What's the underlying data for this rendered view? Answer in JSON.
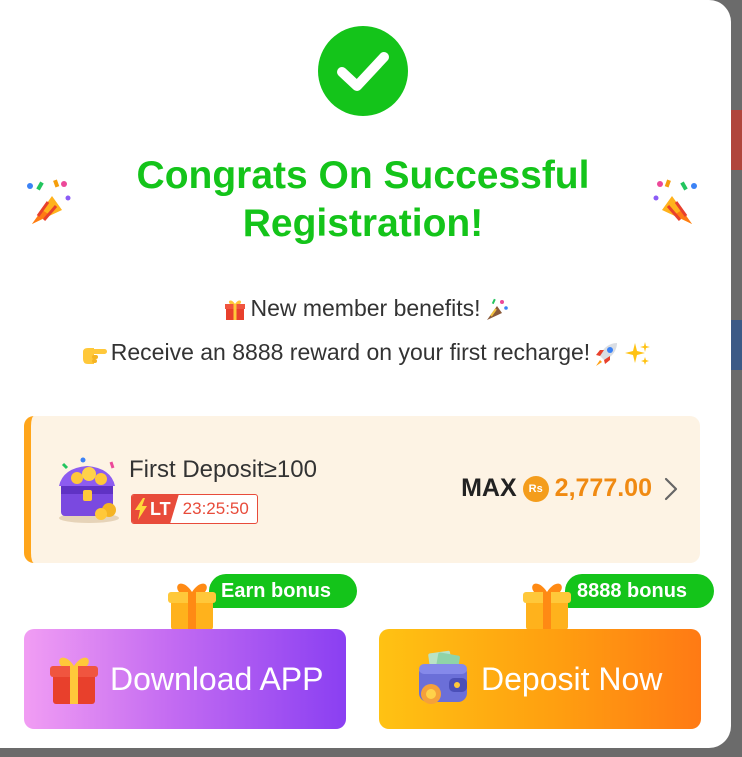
{
  "modal": {
    "title": "Congrats On Successful Registration!",
    "benefits_line": "New member benefits!",
    "reward_line": "Receive an 8888 reward on your first recharge!"
  },
  "deposit_offer": {
    "label": "First Deposit≥100",
    "limited_tag": "LT",
    "countdown": "23:25:50",
    "max_label": "MAX",
    "currency_symbol": "Rs",
    "max_amount": "2,777.00"
  },
  "actions": {
    "download_bonus_tag": "Earn bonus",
    "download_label": "Download APP",
    "deposit_bonus_tag": "8888 bonus",
    "deposit_label": "Deposit Now"
  },
  "icons": {
    "success": "check-circle-icon",
    "party_left": "party-popper-icon",
    "party_right": "party-popper-icon",
    "gift": "gift-icon",
    "pointing": "pointing-hand-icon",
    "rocket": "rocket-icon",
    "sparkles": "sparkles-icon",
    "chest": "treasure-chest-icon",
    "bolt": "lightning-icon",
    "coin": "rupee-coin-icon",
    "chevron": "chevron-right-icon",
    "wallet": "wallet-icon"
  },
  "colors": {
    "success_green": "#14c41a",
    "accent_orange": "#f08a12",
    "card_bg": "#fdf3e4",
    "limited_red": "#e84b3a",
    "download_gradient_start": "#f19df3",
    "download_gradient_end": "#8a3ff2",
    "deposit_gradient_start": "#ffc213",
    "deposit_gradient_end": "#ff7a14"
  }
}
